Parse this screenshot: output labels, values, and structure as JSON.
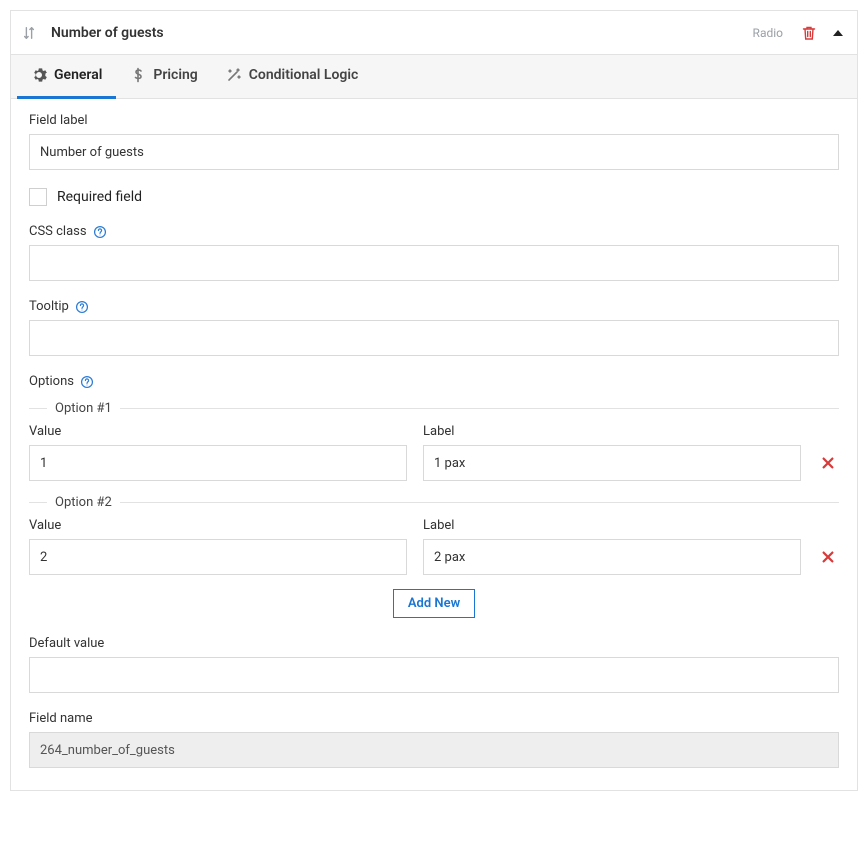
{
  "header": {
    "title": "Number of guests",
    "type_badge": "Radio"
  },
  "tabs": {
    "general": "General",
    "pricing": "Pricing",
    "conditional": "Conditional Logic"
  },
  "labels": {
    "field_label": "Field label",
    "required_field": "Required field",
    "css_class": "CSS class",
    "tooltip": "Tooltip",
    "options": "Options",
    "value": "Value",
    "label": "Label",
    "add_new": "Add New",
    "default_value": "Default value",
    "field_name": "Field name"
  },
  "values": {
    "field_label": "Number of guests",
    "css_class": "",
    "tooltip": "",
    "default_value": "",
    "field_name": "264_number_of_guests",
    "required": false
  },
  "options": [
    {
      "legend": "Option #1",
      "value": "1",
      "label": "1 pax"
    },
    {
      "legend": "Option #2",
      "value": "2",
      "label": "2 pax"
    }
  ]
}
